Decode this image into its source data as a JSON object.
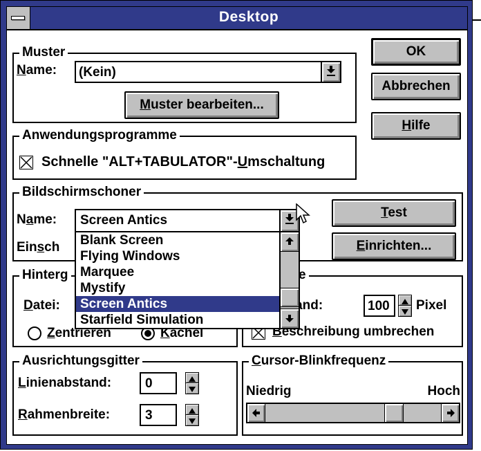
{
  "window": {
    "title": "Desktop",
    "colors": {
      "titlebar": "#303a8a",
      "selection": "#303a8a",
      "face": "#c0c0c0"
    }
  },
  "buttons": {
    "ok": "OK",
    "cancel": "Abbrechen",
    "help_u": "H",
    "help_rest": "ilfe"
  },
  "muster": {
    "group_label": "Muster",
    "name_label_u": "N",
    "name_label_rest": "ame:",
    "name_value": "(Kein)",
    "edit_button_u": "M",
    "edit_button_rest": "uster bearbeiten..."
  },
  "anwendungen": {
    "group_label": "Anwendungsprogramme",
    "checkbox_checked": true,
    "checkbox_label_pre": "Schnelle \"ALT+TABULATOR\"-",
    "checkbox_label_u": "U",
    "checkbox_label_post": "mschaltung"
  },
  "bildschirmschoner": {
    "group_label": "Bildschirmschoner",
    "name_label_pre": "N",
    "name_label_u": "a",
    "name_label_post": "me:",
    "name_value": "Screen Antics",
    "delay_label_pre": "Ein",
    "delay_label_u": "s",
    "delay_label_post": "ch",
    "test_u": "T",
    "test_rest": "est",
    "setup_u": "E",
    "setup_rest": "inrichten...",
    "dropdown_items": [
      "Blank Screen",
      "Flying Windows",
      "Marquee",
      "Mystify",
      "Screen Antics",
      "Starfield Simulation"
    ],
    "selected_index": 4
  },
  "hintergrund": {
    "group_label": "Hinterg",
    "file_label_u": "D",
    "file_label_rest": "atei:",
    "center_u": "Z",
    "center_rest": "entrieren",
    "tile_u": "K",
    "tile_rest": "achel",
    "selected": "tile"
  },
  "symbole": {
    "group_label_fragment": "e",
    "spacing_label_fragment": "abstand:",
    "spacing_value": "100",
    "spacing_unit": "Pixel",
    "wrap_checked": true,
    "wrap_u": "B",
    "wrap_rest": "eschreibung umbrechen"
  },
  "ausrichtung": {
    "group_label": "Ausrichtungsgitter",
    "granularity_u": "L",
    "granularity_rest": "inienabstand:",
    "granularity_value": "0",
    "border_u": "R",
    "border_rest": "ahmenbreite:",
    "border_value": "3"
  },
  "cursor_blink": {
    "group_label_u": "C",
    "group_label_rest": "ursor-Blinkfrequenz",
    "slow_label": "Niedrig",
    "fast_label": "Hoch",
    "slider_fraction": 0.76
  }
}
